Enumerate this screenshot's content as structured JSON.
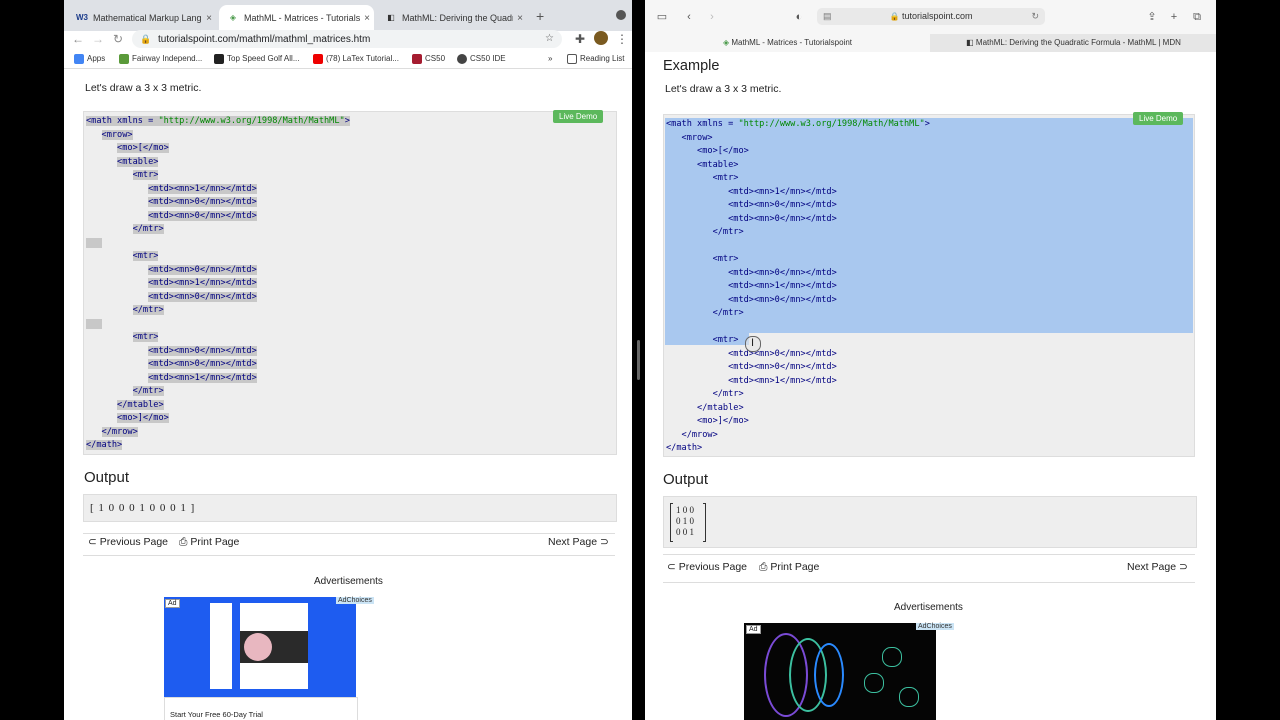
{
  "chrome": {
    "tabs": [
      {
        "favicon": "W3",
        "title": "Mathematical Markup Languag",
        "close": "×"
      },
      {
        "favicon": "◈",
        "title": "MathML - Matrices - Tutorialsp",
        "close": "×"
      },
      {
        "favicon": "◧",
        "title": "MathML: Deriving the Quadratic",
        "close": "×"
      }
    ],
    "new_tab": "+",
    "url": "tutorialspoint.com/mathml/mathml_matrices.htm",
    "bookmarks": [
      "Apps",
      "Fairway Independ...",
      "Top Speed Golf All...",
      "(78) LaTex Tutorial...",
      "CS50",
      "CS50 IDE"
    ],
    "bookmarks_more": "»",
    "reading_list": "Reading List"
  },
  "safari": {
    "address": "tutorialspoint.com",
    "tabs": [
      {
        "title": "MathML - Matrices - Tutorialspoint"
      },
      {
        "title": "MathML: Deriving the Quadratic Formula - MathML | MDN"
      }
    ]
  },
  "content": {
    "heading": "Example",
    "intro": "Let's draw a 3 x 3 metric.",
    "live_demo": "Live Demo",
    "code_lines": [
      "<math xmlns = \"http://www.w3.org/1998/Math/MathML\">",
      "   <mrow>",
      "      <mo>[</mo>",
      "      <mtable>",
      "         <mtr>",
      "            <mtd><mn>1</mn></mtd>",
      "            <mtd><mn>0</mn></mtd>",
      "            <mtd><mn>0</mn></mtd>",
      "         </mtr>",
      "",
      "         <mtr>",
      "            <mtd><mn>0</mn></mtd>",
      "            <mtd><mn>1</mn></mtd>",
      "            <mtd><mn>0</mn></mtd>",
      "         </mtr>",
      "",
      "         <mtr>",
      "            <mtd><mn>0</mn></mtd>",
      "            <mtd><mn>0</mn></mtd>",
      "            <mtd><mn>1</mn></mtd>",
      "         </mtr>",
      "      </mtable>",
      "      <mo>]</mo>",
      "   </mrow>",
      "</math>"
    ],
    "output_heading": "Output",
    "output_chrome": "[ 1 0 0 0 1 0 0 0 1 ]",
    "output_matrix": [
      [
        "1",
        "0",
        "0"
      ],
      [
        "0",
        "1",
        "0"
      ],
      [
        "0",
        "0",
        "1"
      ]
    ],
    "prev_page": "Previous Page",
    "print_page": "Print Page",
    "next_page": "Next Page",
    "advertisements": "Advertisements",
    "ad_badge": "Ad",
    "ad_choices": "AdChoices",
    "ad_caption": "Start Your Free 60-Day Trial"
  },
  "colors": {
    "live_demo": "#5cb85c",
    "code_tag": "#000080",
    "code_string": "#008000",
    "selection": "#a9c8ef",
    "ad_blue": "#1e5cf0"
  }
}
